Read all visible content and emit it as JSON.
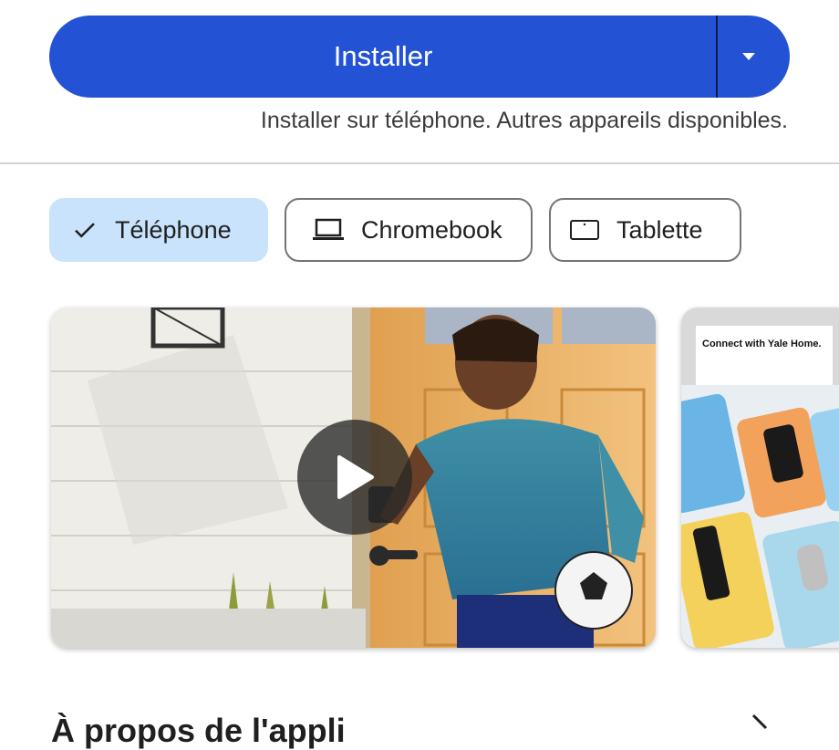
{
  "install": {
    "label": "Installer",
    "subtext": "Installer sur téléphone. Autres appareils disponibles.",
    "dropdown_icon": "dropdown-arrow-icon",
    "color": "#2352d4"
  },
  "device_chips": [
    {
      "label": "Téléphone",
      "icon": "check-icon",
      "selected": true
    },
    {
      "label": "Chromebook",
      "icon": "laptop-icon",
      "selected": false
    },
    {
      "label": "Tablette",
      "icon": "tablet-icon",
      "selected": false
    }
  ],
  "media": {
    "video_play_icon": "play-icon",
    "screenshot_caption": "Connect with Yale Home."
  },
  "about": {
    "title": "À propos de l'appli",
    "arrow_icon": "arrow-right-icon"
  },
  "colors": {
    "chip_selected_bg": "#c9e3fc",
    "chip_border": "#747474"
  }
}
